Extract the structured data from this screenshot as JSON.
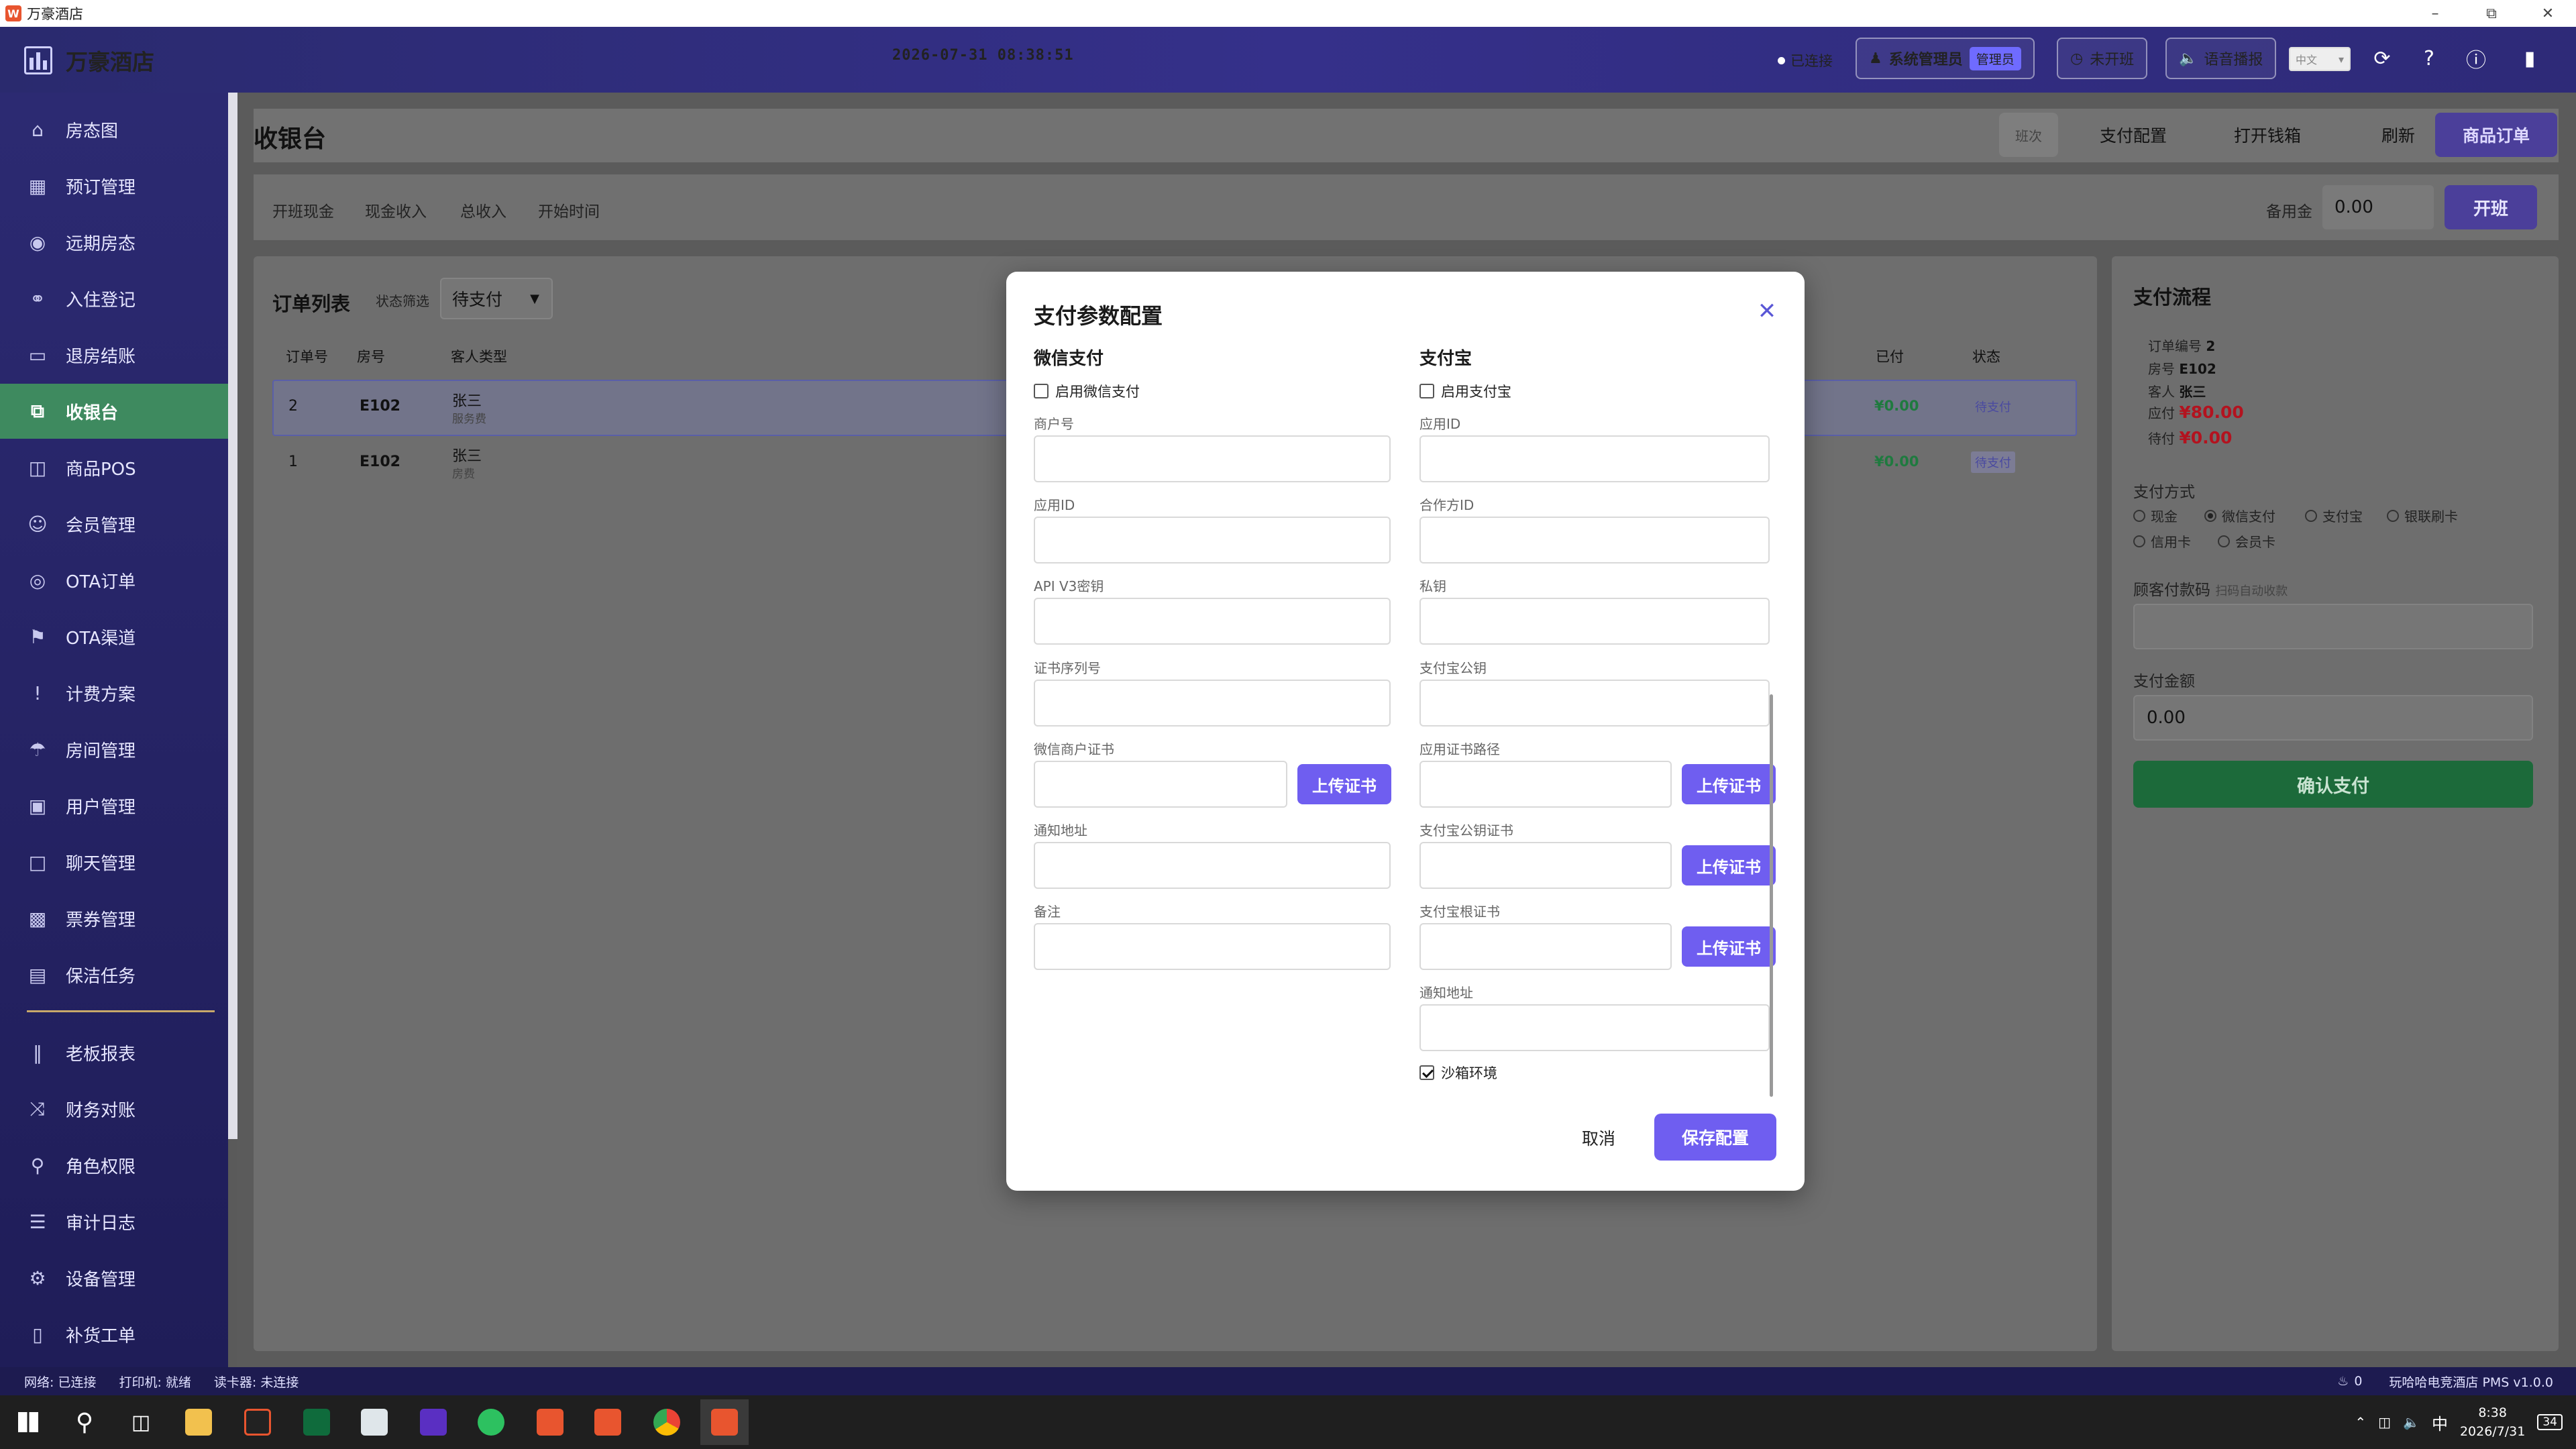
{
  "window": {
    "title": "万豪酒店",
    "app_icon_letter": "W"
  },
  "header": {
    "brand": "万豪酒店",
    "clock": "2026-07-31 08:38:51",
    "connection": "已连接",
    "admin_label": "系统管理员",
    "admin_badge": "管理员",
    "shift_label": "未开班",
    "voice_label": "语音播报",
    "lang_value": "中文"
  },
  "sidebar": {
    "items": [
      {
        "label": "房态图",
        "icon": "home-icon"
      },
      {
        "label": "预订管理",
        "icon": "calendar-icon"
      },
      {
        "label": "远期房态",
        "icon": "eye-icon"
      },
      {
        "label": "入住登记",
        "icon": "headset-icon"
      },
      {
        "label": "退房结账",
        "icon": "card-icon"
      },
      {
        "label": "收银台",
        "icon": "copy-icon",
        "active": true
      },
      {
        "label": "商品POS",
        "icon": "bag-icon"
      },
      {
        "label": "会员管理",
        "icon": "user-icon"
      },
      {
        "label": "OTA订单",
        "icon": "globe-icon"
      },
      {
        "label": "OTA渠道",
        "icon": "flag-icon"
      },
      {
        "label": "计费方案",
        "icon": "exclamation-icon"
      },
      {
        "label": "房间管理",
        "icon": "sign-icon"
      },
      {
        "label": "用户管理",
        "icon": "monitor-icon"
      },
      {
        "label": "聊天管理",
        "icon": "chat-icon"
      },
      {
        "label": "票券管理",
        "icon": "ticket-icon"
      },
      {
        "label": "保洁任务",
        "icon": "chip-icon"
      },
      {
        "label": "老板报表",
        "icon": "bars-icon"
      },
      {
        "label": "财务对账",
        "icon": "fork-icon"
      },
      {
        "label": "角色权限",
        "icon": "key-icon"
      },
      {
        "label": "审计日志",
        "icon": "list-icon"
      },
      {
        "label": "设备管理",
        "icon": "gear-icon"
      },
      {
        "label": "补货工单",
        "icon": "square-icon"
      }
    ]
  },
  "page": {
    "title": "收银台",
    "toolbar": {
      "shift_btn": "班次",
      "pay_config": "支付配置",
      "open_drawer": "打开钱箱",
      "refresh": "刷新",
      "goods_order": "商品订单"
    },
    "stats": [
      "开班现金",
      "现金收入",
      "总收入",
      "开始时间"
    ],
    "petty_label": "备用金",
    "petty_value": "0.00",
    "open_shift": "开班"
  },
  "orders": {
    "title": "订单列表",
    "filter_label": "状态筛选",
    "filter_value": "待支付",
    "columns": {
      "id": "订单号",
      "room": "房号",
      "guest": "客人类型",
      "paid": "已付",
      "status": "状态"
    },
    "rows": [
      {
        "id": "2",
        "room": "E102",
        "guest": "张三",
        "type": "服务费",
        "paid": "¥0.00",
        "status": "待支付"
      },
      {
        "id": "1",
        "room": "E102",
        "guest": "张三",
        "type": "房费",
        "paid": "¥0.00",
        "status": "待支付"
      }
    ]
  },
  "flow": {
    "title": "支付流程",
    "info": {
      "order_label": "订单编号",
      "order_value": "2",
      "room_label": "房号",
      "room_value": "E102",
      "guest_label": "客人",
      "guest_value": "张三",
      "due_label": "应付",
      "due_value": "¥80.00",
      "pending_label": "待付",
      "pending_value": "¥0.00"
    },
    "method_label": "支付方式",
    "methods": [
      "现金",
      "微信支付",
      "支付宝",
      "银联刷卡",
      "信用卡",
      "会员卡"
    ],
    "selected_method": "微信支付",
    "code_label": "顾客付款码",
    "code_hint": "扫码自动收款",
    "amount_label": "支付金额",
    "amount_value": "0.00",
    "confirm": "确认支付"
  },
  "modal": {
    "title": "支付参数配置",
    "wechat": {
      "title": "微信支付",
      "enable": "启用微信支付",
      "fields": [
        "商户号",
        "应用ID",
        "API V3密钥",
        "证书序列号",
        "微信商户证书",
        "通知地址",
        "备注"
      ]
    },
    "alipay": {
      "title": "支付宝",
      "enable": "启用支付宝",
      "fields": [
        "应用ID",
        "合作方ID",
        "私钥",
        "支付宝公钥",
        "应用证书路径",
        "支付宝公钥证书",
        "支付宝根证书",
        "通知地址"
      ],
      "sandbox": "沙箱环境"
    },
    "upload": "上传证书",
    "cancel": "取消",
    "save": "保存配置"
  },
  "statusbar": {
    "network": "网络: 已连接",
    "printer": "打印机: 就绪",
    "reader": "读卡器: 未连接",
    "notif_count": "0",
    "version": "玩哈哈电竞酒店 PMS v1.0.0"
  },
  "taskbar": {
    "time": "8:38",
    "date": "2026/7/31",
    "ime": "中",
    "notif": "34"
  }
}
